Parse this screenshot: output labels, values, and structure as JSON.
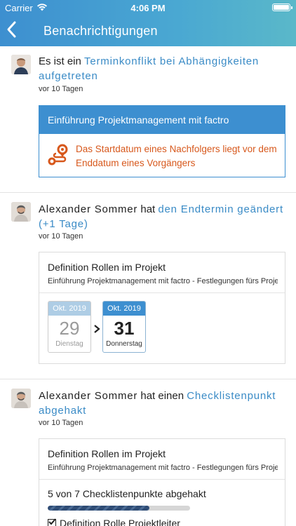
{
  "status": {
    "carrier": "Carrier",
    "time": "4:06 PM"
  },
  "nav": {
    "title": "Benachrichtigungen"
  },
  "notifications": [
    {
      "prefix": "Es ist ein ",
      "link": "Terminkonflikt bei Abhängigkeiten aufgetreten",
      "time": "vor 10 Tagen",
      "card_title": "Einführung Projektmanagement mit factro",
      "message": "Das Startdatum eines Nachfolgers liegt vor dem Enddatum eines Vorgängers"
    },
    {
      "user": "Alexander Sommer",
      "verb": " hat ",
      "link": "den Endtermin geändert (+1 Tage)",
      "time": "vor 10 Tagen",
      "task_title": "Definition Rollen im Projekt",
      "task_path": "Einführung Projektmanagement mit factro - Festlegungen fürs Projekt",
      "old_date": {
        "month": "Okt. 2019",
        "day": "29",
        "weekday": "Dienstag"
      },
      "new_date": {
        "month": "Okt. 2019",
        "day": "31",
        "weekday": "Donnerstag"
      }
    },
    {
      "user": "Alexander Sommer",
      "verb": " hat einen ",
      "link": "Checklistenpunkt abgehakt",
      "time": "vor 10 Tagen",
      "task_title": "Definition Rollen im Projekt",
      "task_path": "Einführung Projektmanagement mit factro - Festlegungen fürs Projekt",
      "progress_label": "5 von 7 Checklistenpunkte abgehakt",
      "progress_fraction": 0.714,
      "checklist_item": "Definition Rolle Projektleiter"
    }
  ],
  "colors": {
    "accent": "#3d8fd0",
    "link": "#3a8bc6",
    "warning": "#d7581c"
  }
}
